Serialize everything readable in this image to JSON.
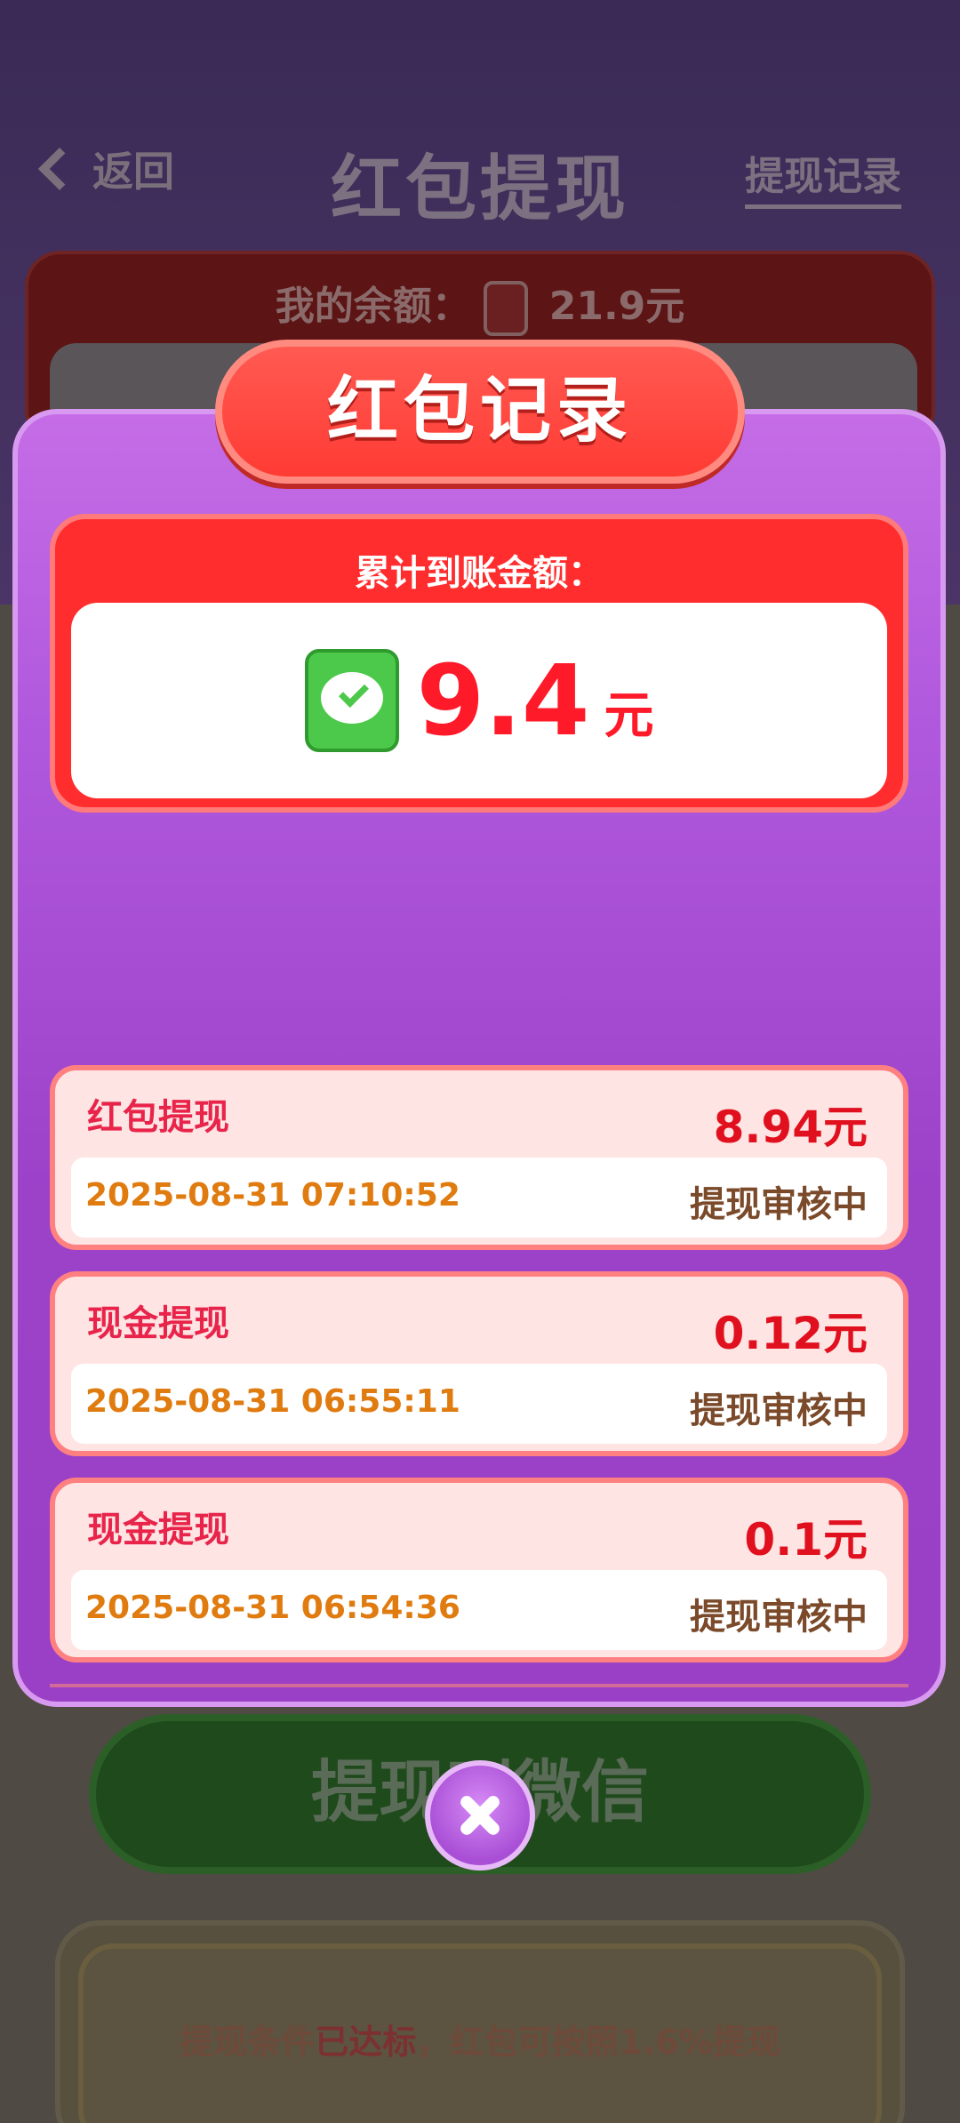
{
  "header": {
    "back_label": "返回",
    "title": "红包提现",
    "history_label": "提现记录"
  },
  "balance": {
    "label": "我的余额：",
    "amount": "21.9元"
  },
  "background": {
    "withdraw_button": "提现到微信",
    "note_prefix": "提现条件",
    "note_highlight": "已达标",
    "note_suffix": "，红包可按照1.6%提现"
  },
  "modal": {
    "title": "红包记录",
    "total_label": "累计到账金额：",
    "total_amount": "9.4",
    "total_unit": "元",
    "records": [
      {
        "type": "红包提现",
        "amount": "8.94元",
        "time": "2025-08-31 07:10:52",
        "status": "提现审核中"
      },
      {
        "type": "现金提现",
        "amount": "0.12元",
        "time": "2025-08-31 06:55:11",
        "status": "提现审核中"
      },
      {
        "type": "现金提现",
        "amount": "0.1元",
        "time": "2025-08-31 06:54:36",
        "status": "提现审核中"
      }
    ]
  },
  "colors": {
    "accent_red": "#ff2d2d",
    "modal_purple": "#b058dd",
    "amount_red": "#e0101e",
    "time_orange": "#e07b10"
  },
  "icons": [
    "chevron-left-icon",
    "red-envelope-icon",
    "wechat-icon",
    "close-icon"
  ]
}
